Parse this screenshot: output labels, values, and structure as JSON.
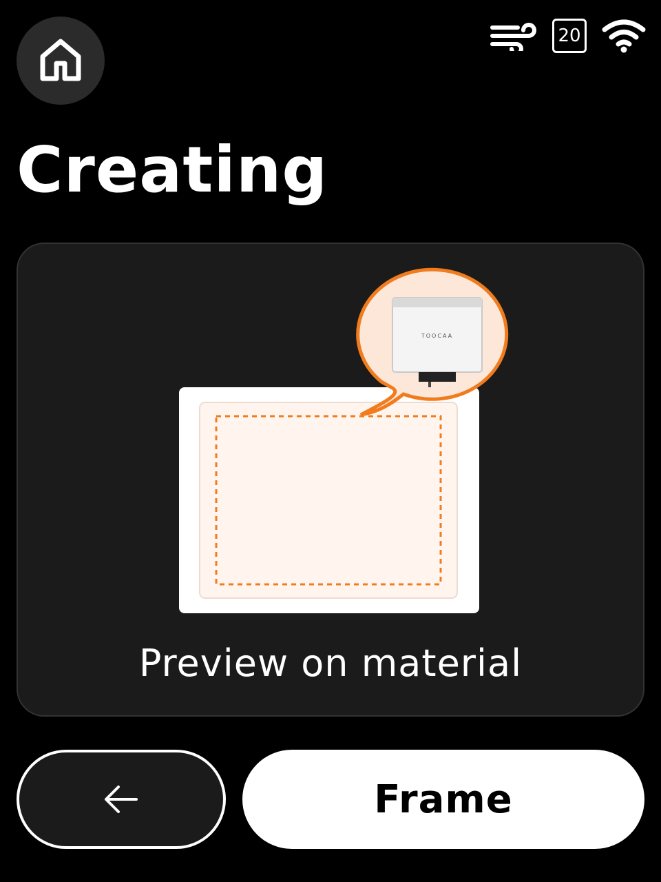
{
  "header": {
    "title": "Creating",
    "home_icon": "home-icon"
  },
  "status_bar": {
    "fan_icon": "fan-airflow-icon",
    "temperature": "20",
    "wifi_icon": "wifi-icon"
  },
  "preview": {
    "caption": "Preview on material",
    "device_logo": "TOOCAA",
    "colors": {
      "card": "#1b1b1b",
      "accent": "#f07c1e",
      "material": "#fff5ee"
    }
  },
  "actions": {
    "back_icon": "arrow-left-icon",
    "frame_label": "Frame"
  }
}
